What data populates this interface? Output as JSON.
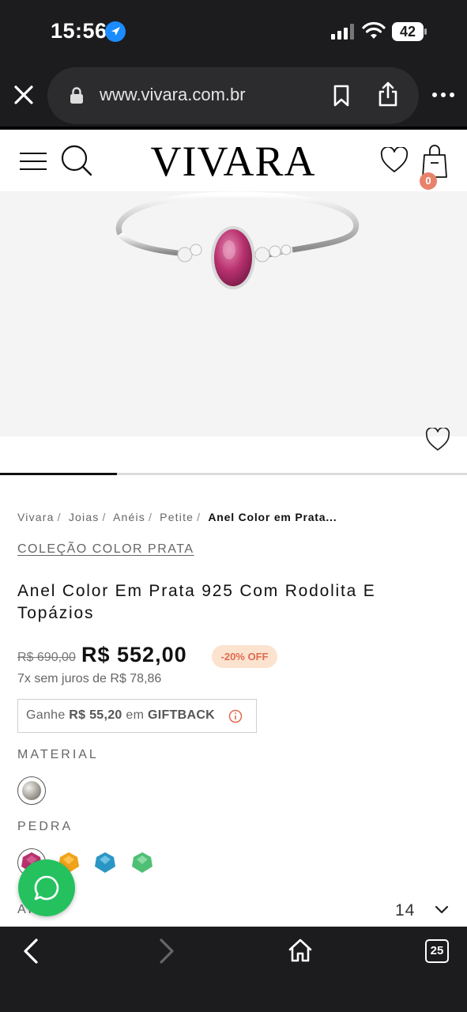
{
  "status_bar": {
    "time": "15:56",
    "battery": "42",
    "icons": [
      "location-arrow-icon",
      "signal-icon",
      "wifi-icon",
      "battery-icon"
    ]
  },
  "browser": {
    "url": "www.vivara.com.br",
    "icons": [
      "close-icon",
      "lock-icon",
      "bookmark-icon",
      "share-icon",
      "more-icon"
    ]
  },
  "header": {
    "brand": "VIVARA",
    "cart_count": "0",
    "icons": [
      "menu-icon",
      "search-icon",
      "heart-icon",
      "shopping-bag-icon"
    ]
  },
  "gallery": {
    "progress": 0.25,
    "icons": [
      "heart-icon"
    ]
  },
  "breadcrumb": {
    "items": [
      "Vivara",
      "Joias",
      "Anéis",
      "Petite"
    ],
    "current": "Anel Color em Prata..."
  },
  "product": {
    "collection": "COLEÇÃO COLOR PRATA",
    "title": "Anel Color Em Prata 925 Com Rodolita E Topázios",
    "old_price": "R$ 690,00",
    "price": "R$ 552,00",
    "discount": "-20% OFF",
    "installments": "7x sem juros de R$ 78,86",
    "giftback_prefix": "Ganhe",
    "giftback_amount": "R$ 55,20",
    "giftback_middle": "em",
    "giftback_word": "GIFTBACK"
  },
  "options": {
    "material_label": "MATERIAL",
    "stone_label": "PEDRA",
    "size_label": "ARO",
    "size_value": "14",
    "colors": {
      "rhodolite": "#b8316e",
      "citrine": "#f0a21a",
      "blue_topaz": "#2a96c4",
      "green": "#4fbf74",
      "discount_text": "#e06b4f",
      "whatsapp": "#25c15f"
    }
  },
  "toolbar": {
    "tabs_count": "25",
    "icons": [
      "back-icon",
      "forward-icon",
      "home-icon",
      "tabs-icon"
    ]
  }
}
